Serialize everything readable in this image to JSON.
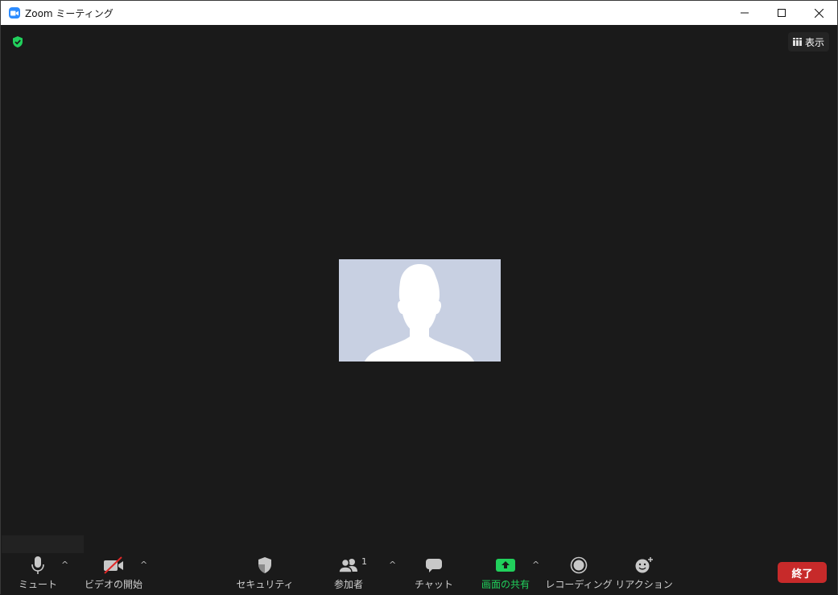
{
  "window": {
    "title": "Zoom ミーティング",
    "controls": {
      "minimize": "—",
      "maximize": "☐",
      "close": "✕"
    }
  },
  "top_overlay": {
    "security_status_icon": "shield-check-icon",
    "view_label": "表示"
  },
  "participant": {
    "avatar": "default-person-silhouette"
  },
  "toolbar": {
    "mute_label": "ミュート",
    "video_label": "ビデオの開始",
    "security_label": "セキュリティ",
    "participants_label": "参加者",
    "participants_count": "1",
    "chat_label": "チャット",
    "share_label": "画面の共有",
    "record_label": "レコーディング",
    "reactions_label": "リアクション",
    "end_label": "終了",
    "caret": "^"
  },
  "colors": {
    "background": "#1a1a1a",
    "share_green": "#21d05c",
    "end_red": "#c72a2a",
    "security_green": "#21d05c",
    "avatar_bg": "#c8d0e2"
  }
}
